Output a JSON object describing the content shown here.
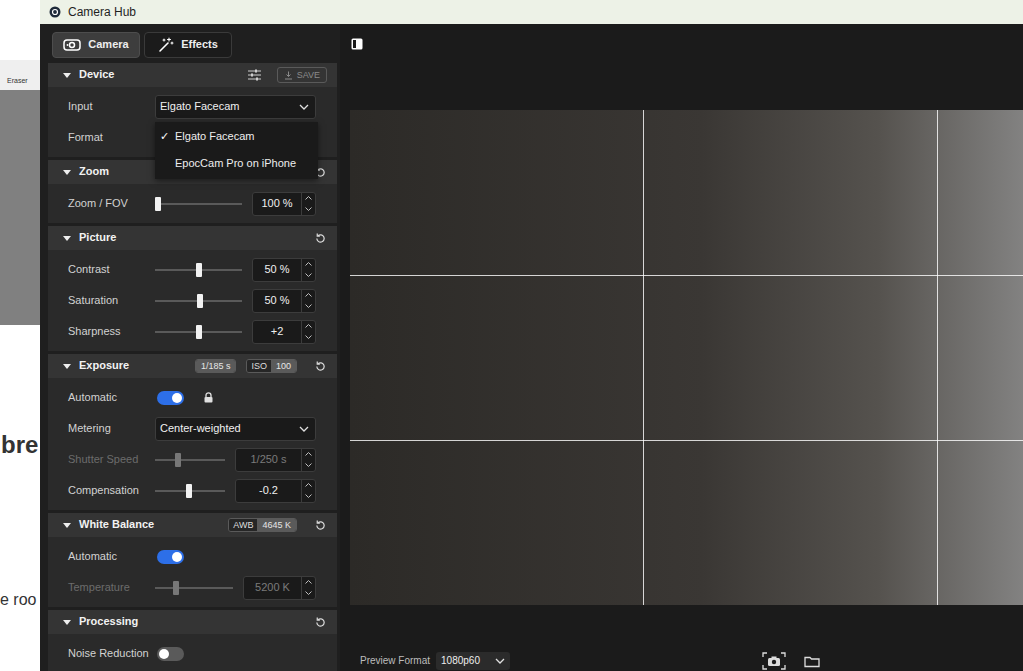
{
  "background_window": {
    "toolbar_label": "Eraser",
    "heading": "bre",
    "text": "e roo"
  },
  "window": {
    "title": "Camera Hub"
  },
  "tabs": [
    {
      "label": "Camera",
      "selected": true
    },
    {
      "label": "Effects",
      "selected": false
    }
  ],
  "sections": [
    {
      "title": "Device",
      "kind": "device",
      "expanded": true,
      "save": "SAVE",
      "save_enabled": false,
      "badges": [],
      "rows": [
        {
          "kind": "select",
          "label": "Input",
          "value": "Elgato Facecam",
          "open": true
        },
        {
          "kind": "covered",
          "label": "Format"
        }
      ]
    },
    {
      "title": "Zoom",
      "kind": "resettable",
      "expanded": true,
      "badges": [],
      "rows": [
        {
          "kind": "slider",
          "label": "Zoom / FOV",
          "level": 0.0,
          "value": "100 %",
          "disabled": false
        }
      ]
    },
    {
      "title": "Picture",
      "kind": "resettable",
      "expanded": true,
      "badges": [],
      "rows": [
        {
          "kind": "slider",
          "label": "Contrast",
          "level": 0.5,
          "value": "50 %",
          "disabled": false
        },
        {
          "kind": "slider",
          "label": "Saturation",
          "level": 0.52,
          "value": "50 %",
          "disabled": false
        },
        {
          "kind": "slider",
          "label": "Sharpness",
          "level": 0.5,
          "value": "+2",
          "disabled": false
        }
      ]
    },
    {
      "title": "Exposure",
      "kind": "resettable",
      "expanded": true,
      "badges": [
        {
          "value": "1/185 s"
        },
        {
          "label": "ISO",
          "value": "100"
        }
      ],
      "rows": [
        {
          "kind": "toggle",
          "label": "Automatic",
          "on": true,
          "locked": true
        },
        {
          "kind": "select",
          "label": "Metering",
          "value": "Center-weighted",
          "open": false
        },
        {
          "kind": "slider",
          "label": "Shutter Speed",
          "level": 0.31,
          "value": "1/250 s",
          "disabled": true
        },
        {
          "kind": "slider",
          "label": "Compensation",
          "level": 0.48,
          "value": "-0.2",
          "disabled": false
        }
      ]
    },
    {
      "title": "White Balance",
      "kind": "resettable",
      "expanded": true,
      "badges": [
        {
          "label": "AWB",
          "value": "4645 K"
        }
      ],
      "rows": [
        {
          "kind": "toggle",
          "label": "Automatic",
          "on": true
        },
        {
          "kind": "slider",
          "label": "Temperature",
          "level": 0.25,
          "value": "5200 K",
          "disabled": true
        }
      ]
    },
    {
      "title": "Processing",
      "kind": "resettable",
      "expanded": true,
      "badges": [],
      "rows": [
        {
          "kind": "toggle",
          "label": "Noise Reduction",
          "on": false
        }
      ]
    }
  ],
  "input_menu": {
    "check_mark": "✓",
    "items": [
      {
        "label": "Elgato Facecam",
        "selected": true
      },
      {
        "label": "EpocCam Pro on iPhone",
        "selected": false
      }
    ]
  },
  "preview": {
    "grid": true
  },
  "bottom_bar": {
    "label": "Preview Format",
    "format": "1080p60"
  }
}
